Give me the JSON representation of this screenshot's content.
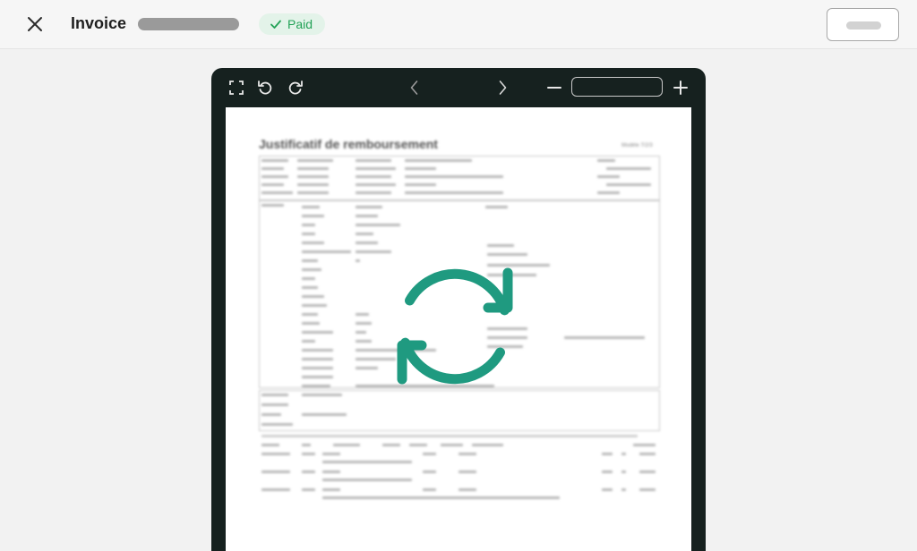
{
  "header": {
    "close_icon": "close-icon",
    "title": "Invoice",
    "status": {
      "label": "Paid",
      "icon": "check-icon",
      "color": "#23a257",
      "background": "#e3f3e9"
    }
  },
  "viewer": {
    "toolbar": {
      "fullscreen_icon": "fullscreen-icon",
      "rotate_left_icon": "rotate-left-icon",
      "rotate_right_icon": "rotate-right-icon",
      "prev_icon": "chevron-left-icon",
      "next_icon": "chevron-right-icon",
      "zoom_out_icon": "minus-icon",
      "zoom_in_icon": "plus-icon",
      "zoom_value": ""
    },
    "document": {
      "title": "Justificatif de remboursement",
      "reference": "Modèle 7/2/3"
    },
    "loading_icon": "refresh-icon",
    "accent_color": "#1f9a80"
  }
}
